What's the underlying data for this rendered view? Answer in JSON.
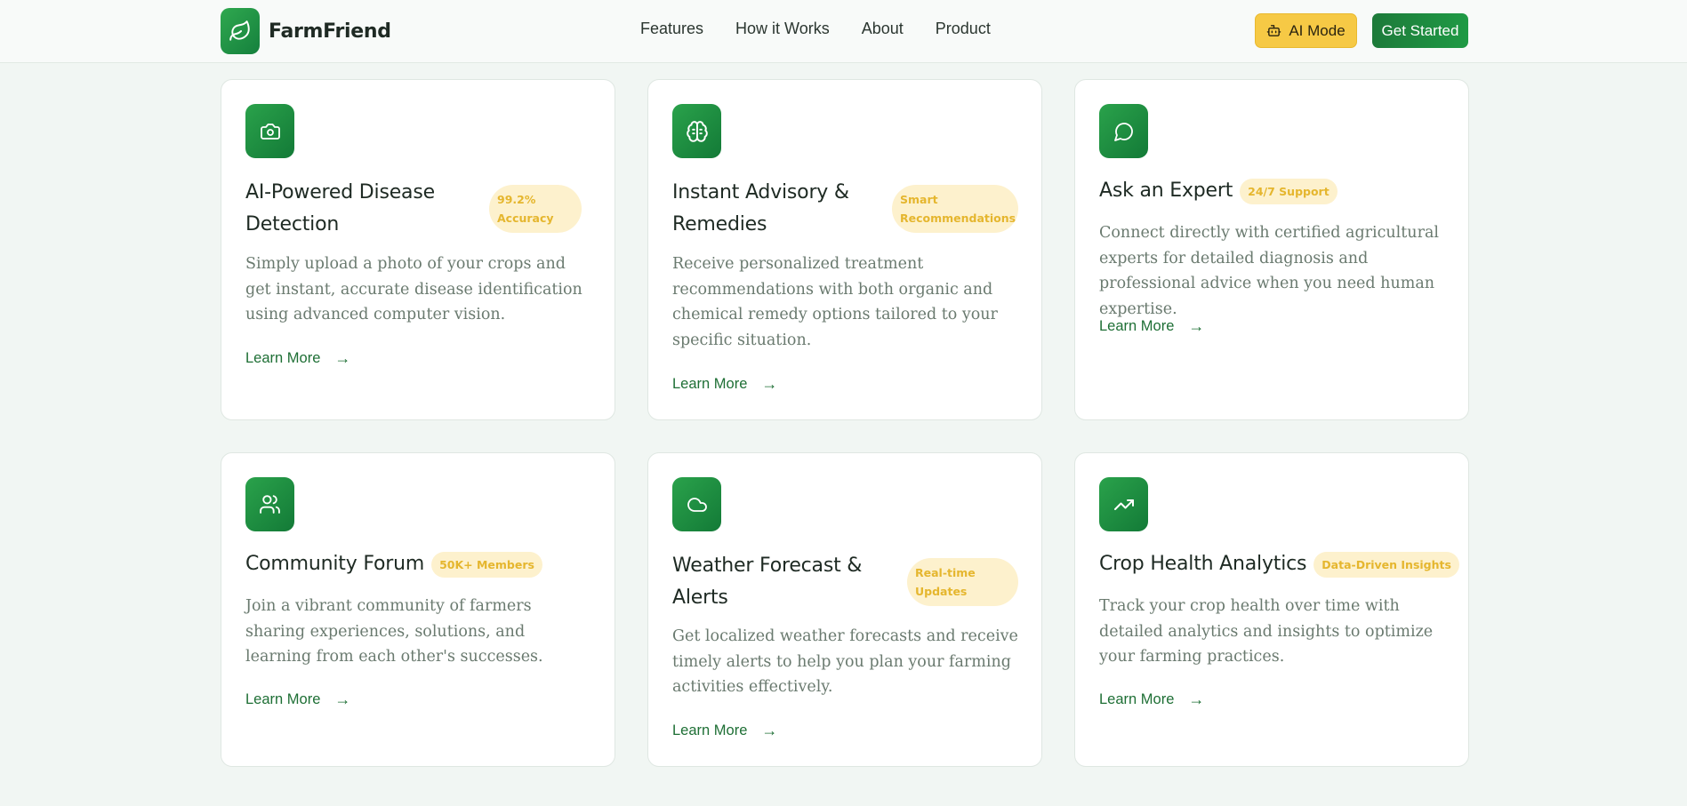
{
  "brand": {
    "name": "FarmFriend",
    "logo_icon": "leaf-icon"
  },
  "nav": {
    "links": [
      "Features",
      "How it Works",
      "About",
      "Product"
    ],
    "ai_mode_label": "AI Mode",
    "ai_mode_icon": "robot-icon",
    "get_started_label": "Get Started"
  },
  "colors": {
    "accent_green": "#1f8c40",
    "badge_bg": "#fdf1cd",
    "badge_text": "#e5b62e",
    "ai_button": "#f6c945"
  },
  "features": [
    {
      "icon": "camera-icon",
      "title": "AI-Powered Disease Detection",
      "badge": "99.2% Accuracy",
      "description": "Simply upload a photo of your crops and get instant, accurate disease identification using advanced computer vision.",
      "link": "Learn More",
      "arrow": "→"
    },
    {
      "icon": "brain-icon",
      "title": "Instant Advisory & Remedies",
      "badge": "Smart Recommendations",
      "description": "Receive personalized treatment recommendations with both organic and chemical remedy options tailored to your specific situation.",
      "link": "Learn More",
      "arrow": "→"
    },
    {
      "icon": "chat-icon",
      "title": "Ask an Expert",
      "badge": "24/7 Support",
      "description": "Connect directly with certified agricultural experts for detailed diagnosis and professional advice when you need human expertise.",
      "link": "Learn More",
      "arrow": "→"
    },
    {
      "icon": "users-icon",
      "title": "Community Forum",
      "badge": "50K+ Members",
      "description": "Join a vibrant community of farmers sharing experiences, solutions, and learning from each other's successes.",
      "link": "Learn More",
      "arrow": "→"
    },
    {
      "icon": "cloud-icon",
      "title": "Weather Forecast & Alerts",
      "badge": "Real-time Updates",
      "description": "Get localized weather forecasts and receive timely alerts to help you plan your farming activities effectively.",
      "link": "Learn More",
      "arrow": "→"
    },
    {
      "icon": "trending-up-icon",
      "title": "Crop Health Analytics",
      "badge": "Data-Driven Insights",
      "description": "Track your crop health over time with detailed analytics and insights to optimize your farming practices.",
      "link": "Learn More",
      "arrow": "→"
    }
  ]
}
